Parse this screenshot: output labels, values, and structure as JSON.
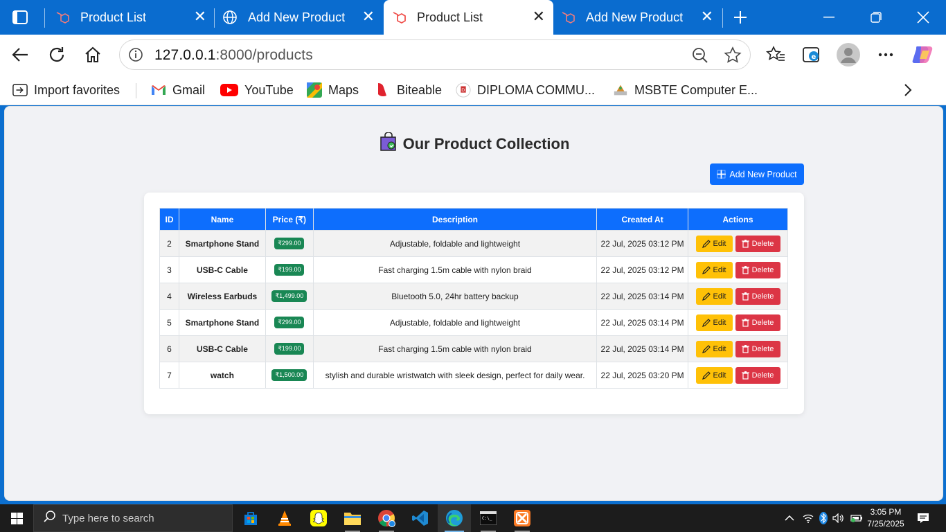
{
  "browser": {
    "tabs": [
      {
        "label": "Product List",
        "icon": "laravel-icon",
        "active": false
      },
      {
        "label": "Add New Product",
        "icon": "globe-icon",
        "active": false
      },
      {
        "label": "Product List",
        "icon": "laravel-icon",
        "active": true
      },
      {
        "label": "Add New Product",
        "icon": "laravel-icon",
        "active": false
      }
    ],
    "url_host": "127.0.0.1",
    "url_rest": ":8000/products",
    "favorites": [
      {
        "label": "Import favorites",
        "icon": "import-icon"
      },
      {
        "label": "Gmail",
        "icon": "gmail-icon"
      },
      {
        "label": "YouTube",
        "icon": "youtube-icon"
      },
      {
        "label": "Maps",
        "icon": "maps-icon"
      },
      {
        "label": "Biteable",
        "icon": "biteable-icon"
      },
      {
        "label": "DIPLOMA COMMU...",
        "icon": "diploma-icon"
      },
      {
        "label": "MSBTE Computer E...",
        "icon": "msbte-icon"
      }
    ]
  },
  "page": {
    "title": "Our Product Collection",
    "add_button": "Add New Product",
    "columns": [
      "ID",
      "Name",
      "Price (₹)",
      "Description",
      "Created At",
      "Actions"
    ],
    "edit_label": "Edit",
    "delete_label": "Delete",
    "rows": [
      {
        "id": "2",
        "name": "Smartphone Stand",
        "price": "₹299.00",
        "description": "Adjustable, foldable and lightweight",
        "created": "22 Jul, 2025 03:12 PM"
      },
      {
        "id": "3",
        "name": "USB-C Cable",
        "price": "₹199.00",
        "description": "Fast charging 1.5m cable with nylon braid",
        "created": "22 Jul, 2025 03:12 PM"
      },
      {
        "id": "4",
        "name": "Wireless Earbuds",
        "price": "₹1,499.00",
        "description": "Bluetooth 5.0, 24hr battery backup",
        "created": "22 Jul, 2025 03:14 PM"
      },
      {
        "id": "5",
        "name": "Smartphone Stand",
        "price": "₹299.00",
        "description": "Adjustable, foldable and lightweight",
        "created": "22 Jul, 2025 03:14 PM"
      },
      {
        "id": "6",
        "name": "USB-C Cable",
        "price": "₹199.00",
        "description": "Fast charging 1.5m cable with nylon braid",
        "created": "22 Jul, 2025 03:14 PM"
      },
      {
        "id": "7",
        "name": "watch",
        "price": "₹1,500.00",
        "description": "stylish and durable wristwatch with sleek design, perfect for daily wear.",
        "created": "22 Jul, 2025 03:20 PM"
      }
    ]
  },
  "taskbar": {
    "search_placeholder": "Type here to search",
    "time": "3:05 PM",
    "date": "7/25/2025"
  },
  "colors": {
    "primary": "#0d6efd",
    "success": "#198754",
    "warning": "#ffc107",
    "danger": "#dc3545"
  }
}
